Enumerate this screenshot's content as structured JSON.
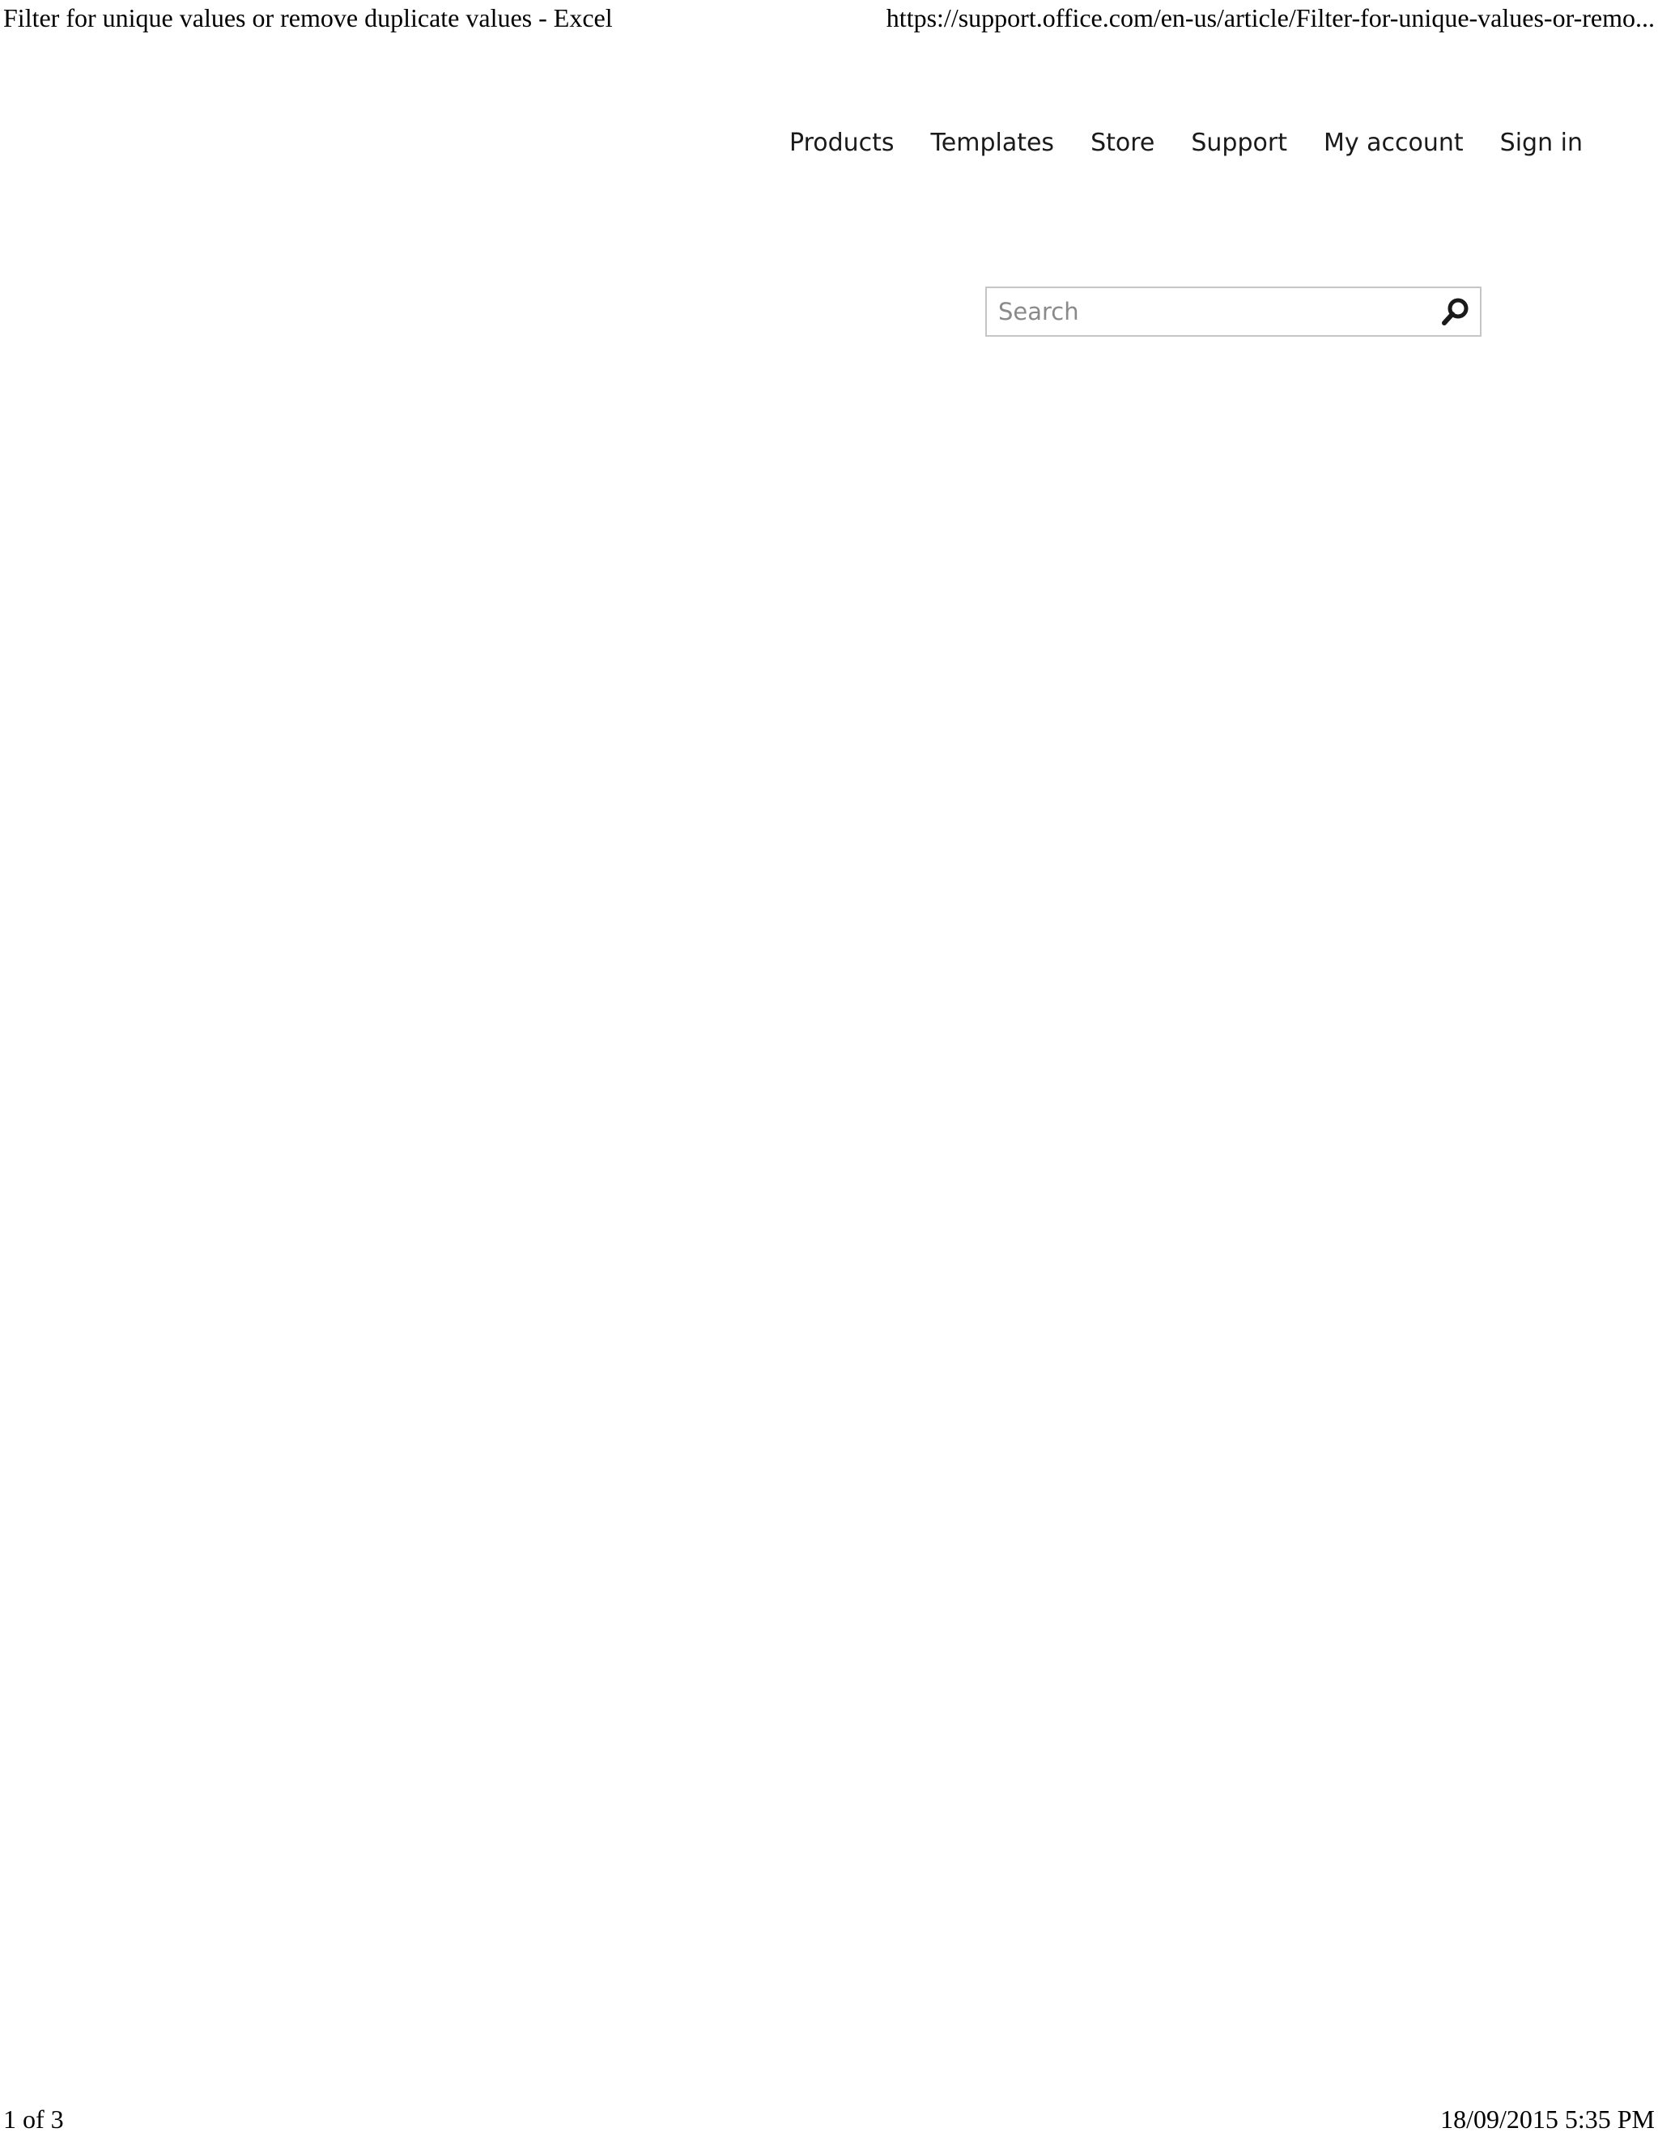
{
  "print_header": {
    "title": "Filter for unique values or remove duplicate values - Excel",
    "url": "https://support.office.com/en-us/article/Filter-for-unique-values-or-remo..."
  },
  "nav": {
    "items": [
      {
        "label": "Products"
      },
      {
        "label": "Templates"
      },
      {
        "label": "Store"
      },
      {
        "label": "Support"
      },
      {
        "label": "My account"
      },
      {
        "label": "Sign in"
      }
    ]
  },
  "search": {
    "placeholder": "Search",
    "value": "",
    "icon": "search-icon"
  },
  "print_footer": {
    "page": "1 of 3",
    "datetime": "18/09/2015 5:35 PM"
  }
}
